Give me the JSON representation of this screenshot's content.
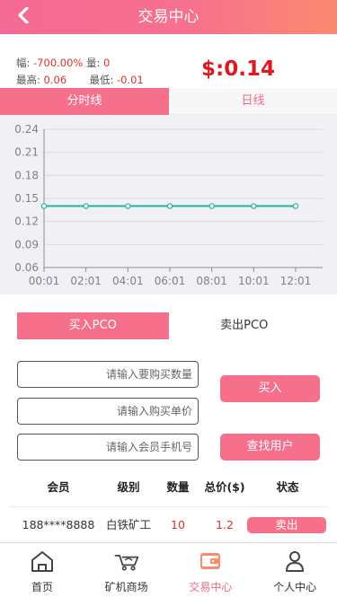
{
  "header": {
    "title": "交易中心",
    "back_icon": "chevron-left-icon"
  },
  "stats": {
    "change_label": "幅:",
    "change_value": "-700.00%",
    "volume_label": "量:",
    "volume_value": "0",
    "high_label": "最高:",
    "high_value": "0.06",
    "low_label": "最低:",
    "low_value": "-0.01",
    "price": "$:0.14"
  },
  "chart_tabs": [
    {
      "label": "分时线",
      "active": true
    },
    {
      "label": "日线",
      "active": false
    }
  ],
  "chart_data": {
    "type": "line",
    "x": [
      "00:01",
      "02:01",
      "04:01",
      "06:01",
      "08:01",
      "10:01",
      "12:01"
    ],
    "series": [
      {
        "values": [
          0.14,
          0.14,
          0.14,
          0.14,
          0.14,
          0.14,
          0.14
        ],
        "color": "#21b3a3"
      }
    ],
    "y_ticks": [
      "0.24",
      "0.21",
      "0.18",
      "0.15",
      "0.12",
      "0.09",
      "0.06"
    ],
    "ylim": [
      0.06,
      0.24
    ],
    "grid": "horizontal"
  },
  "trade_tabs": [
    {
      "label": "买入PCO",
      "active": true
    },
    {
      "label": "卖出PCO",
      "active": false
    }
  ],
  "form": {
    "quantity_placeholder": "请输入要购买数量",
    "price_placeholder": "请输入购买单价",
    "phone_placeholder": "请输入会员手机号",
    "buy_label": "买入",
    "find_user_label": "查找用户"
  },
  "table": {
    "headers": [
      "会员",
      "级别",
      "数量",
      "总价($)",
      "状态"
    ],
    "rows": [
      {
        "member": "188****8888",
        "level": "白铁矿工",
        "quantity": "10",
        "total": "1.2",
        "action": "卖出"
      }
    ]
  },
  "tabbar": [
    {
      "label": "首页",
      "icon": "home-icon",
      "active": false
    },
    {
      "label": "矿机商场",
      "icon": "mining-cart-icon",
      "active": false
    },
    {
      "label": "交易中心",
      "icon": "wallet-icon",
      "active": true
    },
    {
      "label": "个人中心",
      "icon": "user-icon",
      "active": false
    }
  ],
  "colors": {
    "accent": "#f6708c",
    "price_red": "#e0191f",
    "line": "#21b3a3"
  }
}
